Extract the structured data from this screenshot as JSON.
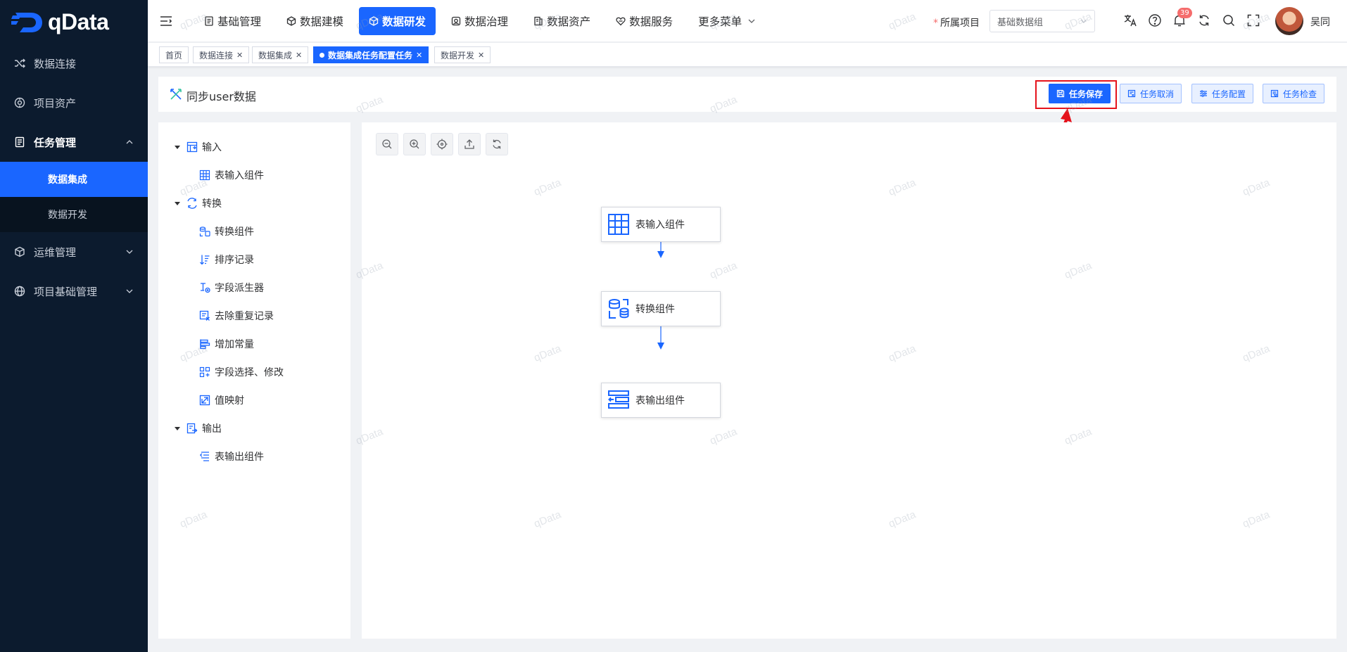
{
  "app": {
    "logo_text": "qData"
  },
  "sidebar": {
    "items": [
      {
        "label": "数据连接",
        "icon": "shuffle-icon"
      },
      {
        "label": "项目资产",
        "icon": "asset-icon"
      },
      {
        "label": "任务管理",
        "icon": "document-icon",
        "expanded": true,
        "children": [
          {
            "label": "数据集成",
            "active": true
          },
          {
            "label": "数据开发",
            "active": false
          }
        ]
      },
      {
        "label": "运维管理",
        "icon": "cube-icon"
      },
      {
        "label": "项目基础管理",
        "icon": "globe-icon"
      }
    ]
  },
  "topnav": {
    "items": [
      {
        "label": "基础管理",
        "icon": "file-icon"
      },
      {
        "label": "数据建模",
        "icon": "cube-icon"
      },
      {
        "label": "数据研发",
        "icon": "cube-icon",
        "active": true
      },
      {
        "label": "数据治理",
        "icon": "shield-icon"
      },
      {
        "label": "数据资产",
        "icon": "stack-icon"
      },
      {
        "label": "数据服务",
        "icon": "heart-icon"
      }
    ],
    "more_label": "更多菜单",
    "project_label": "所属项目",
    "project_value": "基础数据组",
    "notification_count": "39",
    "username": "吴同"
  },
  "tabs": [
    {
      "label": "首页",
      "closable": false,
      "active": false
    },
    {
      "label": "数据连接",
      "closable": true,
      "active": false
    },
    {
      "label": "数据集成",
      "closable": true,
      "active": false
    },
    {
      "label": "数据集成任务配置任务",
      "closable": true,
      "active": true
    },
    {
      "label": "数据开发",
      "closable": true,
      "active": false
    }
  ],
  "page": {
    "title": "同步user数据",
    "buttons": {
      "save": "任务保存",
      "cancel": "任务取消",
      "config": "任务配置",
      "check": "任务检查"
    }
  },
  "tree": {
    "groups": [
      {
        "label": "输入",
        "children": [
          "表输入组件"
        ]
      },
      {
        "label": "转换",
        "children": [
          "转换组件",
          "排序记录",
          "字段派生器",
          "去除重复记录",
          "增加常量",
          "字段选择、修改",
          "值映射"
        ]
      },
      {
        "label": "输出",
        "children": [
          "表输出组件"
        ]
      }
    ]
  },
  "canvas": {
    "toolbar": [
      "zoom-out-icon",
      "zoom-in-icon",
      "locate-icon",
      "export-icon",
      "refresh-icon"
    ],
    "nodes": [
      {
        "label": "表输入组件",
        "icon": "table-grid-icon"
      },
      {
        "label": "转换组件",
        "icon": "transform-db-icon"
      },
      {
        "label": "表输出组件",
        "icon": "table-output-icon"
      }
    ]
  },
  "watermark": "qData",
  "colors": {
    "primary": "#1a66ff",
    "sidebar": "#0c1b2e",
    "highlight": "#e5131c"
  }
}
